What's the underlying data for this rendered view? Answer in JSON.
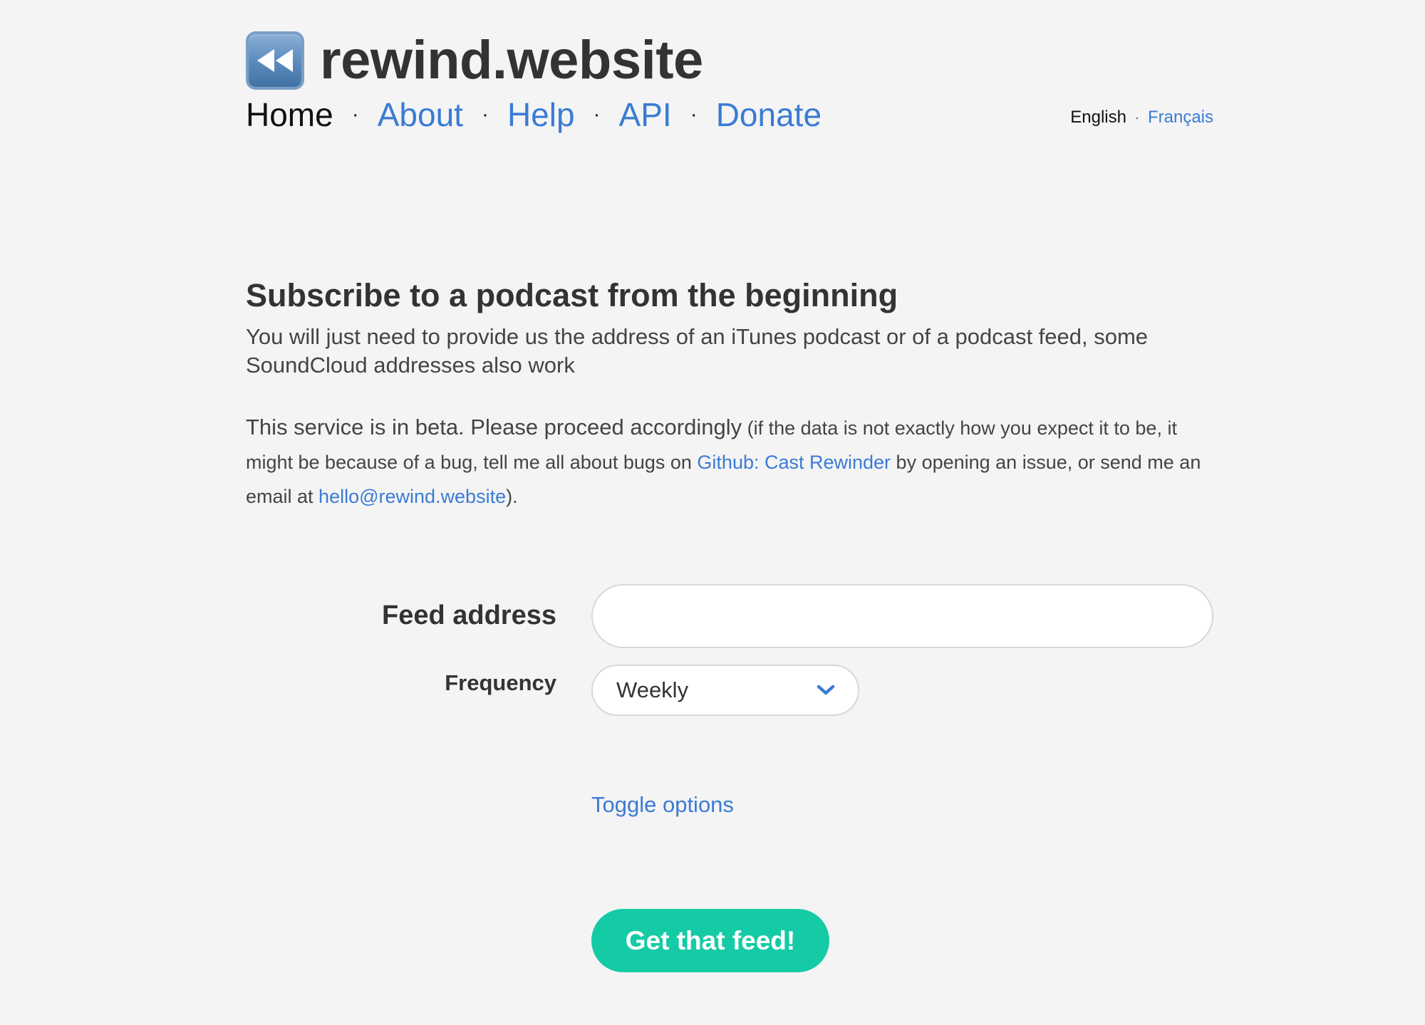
{
  "brand": {
    "icon": "rewind-icon",
    "name": "rewind.website"
  },
  "nav": {
    "items": [
      {
        "label": "Home",
        "current": true
      },
      {
        "label": "About",
        "current": false
      },
      {
        "label": "Help",
        "current": false
      },
      {
        "label": "API",
        "current": false
      },
      {
        "label": "Donate",
        "current": false
      }
    ],
    "separator": "·"
  },
  "languages": {
    "items": [
      {
        "label": "English",
        "current": true
      },
      {
        "label": "Français",
        "current": false
      }
    ],
    "separator": "·"
  },
  "intro": {
    "heading": "Subscribe to a podcast from the beginning",
    "lead": "You will just need to provide us the address of an iTunes podcast or of a podcast feed, some SoundCloud addresses also work"
  },
  "beta": {
    "main": "This service is in beta. Please proceed accordingly",
    "part1": " (if the data is not exactly how you expect it to be, it might be because of a bug, tell me all about bugs on ",
    "github_link": "Github: Cast Rewinder",
    "part2": " by opening an issue, or send me an email at ",
    "email_link": "hello@rewind.website",
    "part3": ")."
  },
  "form": {
    "feed_label": "Feed address",
    "feed_value": "",
    "feed_placeholder": "",
    "frequency_label": "Frequency",
    "frequency_value": "Weekly",
    "toggle_options": "Toggle options",
    "submit_label": "Get that feed!"
  },
  "colors": {
    "background": "#f4f4f4",
    "link": "#3a7bd5",
    "accent": "#14cba6",
    "text": "#333333"
  }
}
